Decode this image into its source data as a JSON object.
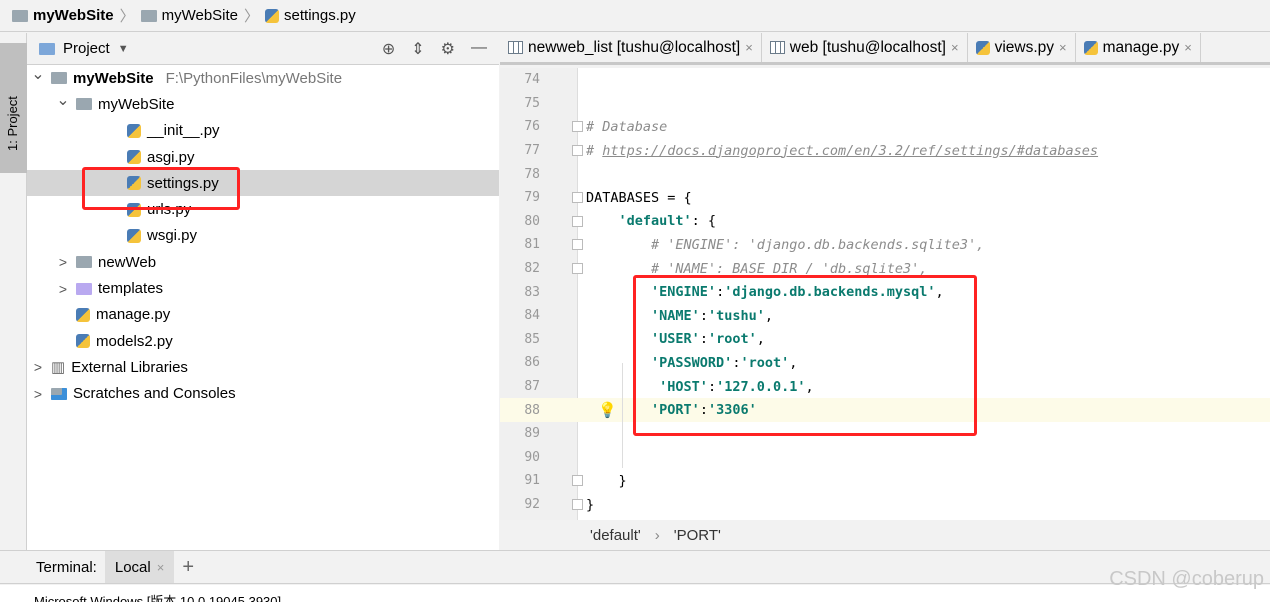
{
  "breadcrumb": [
    "myWebSite",
    "myWebSite",
    "settings.py"
  ],
  "tool_strip": {
    "label": "1: Project"
  },
  "project": {
    "title": "Project",
    "tree": [
      {
        "label": "myWebSite",
        "path": "F:\\PythonFiles\\myWebSite",
        "depth": 0,
        "type": "folder",
        "expanded": true,
        "bold": true
      },
      {
        "label": "myWebSite",
        "depth": 1,
        "type": "folder",
        "expanded": true
      },
      {
        "label": "__init__.py",
        "depth": 2,
        "type": "py"
      },
      {
        "label": "asgi.py",
        "depth": 2,
        "type": "py"
      },
      {
        "label": "settings.py",
        "depth": 2,
        "type": "py",
        "selected": true
      },
      {
        "label": "urls.py",
        "depth": 2,
        "type": "py"
      },
      {
        "label": "wsgi.py",
        "depth": 2,
        "type": "py"
      },
      {
        "label": "newWeb",
        "depth": 1,
        "type": "folder",
        "expanded": false
      },
      {
        "label": "templates",
        "depth": 1,
        "type": "folder-purple",
        "expanded": false
      },
      {
        "label": "manage.py",
        "depth": 1,
        "type": "py"
      },
      {
        "label": "models2.py",
        "depth": 1,
        "type": "py"
      },
      {
        "label": "External Libraries",
        "depth": 0,
        "type": "lib",
        "expanded": false
      },
      {
        "label": "Scratches and Consoles",
        "depth": 0,
        "type": "scratch",
        "expanded": false
      }
    ]
  },
  "tabs": [
    {
      "label": "newweb_list [tushu@localhost]",
      "icon": "table-icon"
    },
    {
      "label": "web [tushu@localhost]",
      "icon": "table-icon"
    },
    {
      "label": "views.py",
      "icon": "python-icon"
    },
    {
      "label": "manage.py",
      "icon": "python-icon"
    }
  ],
  "editor": {
    "current_line": 88,
    "lines": [
      {
        "n": "74",
        "html": ""
      },
      {
        "n": "75",
        "html": ""
      },
      {
        "n": "76",
        "html": "<span class='cm'># Database</span>"
      },
      {
        "n": "77",
        "html": "<span class='cm'># <span class='url'>https://docs.djangoproject.com/en/3.2/ref/settings/#databases</span></span>"
      },
      {
        "n": "78",
        "html": ""
      },
      {
        "n": "79",
        "html": "DATABASES = {"
      },
      {
        "n": "80",
        "html": "    <span class='str'>'default'</span>: {"
      },
      {
        "n": "81",
        "html": "        <span class='cm'># 'ENGINE': 'django.db.backends.sqlite3',</span>"
      },
      {
        "n": "82",
        "html": "        <span class='cm'># 'NAME': BASE_DIR / 'db.sqlite3',</span>"
      },
      {
        "n": "83",
        "html": "        <span class='str'>'ENGINE'</span>:<span class='str'>'django.db.backends.mysql'</span>,"
      },
      {
        "n": "84",
        "html": "        <span class='str'>'NAME'</span>:<span class='str'>'tushu'</span>,"
      },
      {
        "n": "85",
        "html": "        <span class='str'>'USER'</span>:<span class='str'>'root'</span>,"
      },
      {
        "n": "86",
        "html": "        <span class='str'>'PASSWORD'</span>:<span class='str'>'root'</span>,"
      },
      {
        "n": "87",
        "html": "         <span class='str'>'HOST'</span>:<span class='str'>'127.0.0.1'</span>,"
      },
      {
        "n": "88",
        "html": "        <span class='str'>'PORT'</span>:<span class='str'>'3306'</span>"
      },
      {
        "n": "89",
        "html": ""
      },
      {
        "n": "90",
        "html": ""
      },
      {
        "n": "91",
        "html": "    }"
      },
      {
        "n": "92",
        "html": "}"
      }
    ]
  },
  "editor_breadcrumb": [
    "'default'",
    "'PORT'"
  ],
  "terminal": {
    "label": "Terminal:",
    "tab": "Local",
    "output": "Microsoft Windows [版本 10.0.19045.3930]"
  },
  "watermark": "CSDN @coberup",
  "colors": {
    "highlight_box": "#ff2222",
    "string": "#0a7a6e",
    "selected_row": "#d5d5d5"
  }
}
